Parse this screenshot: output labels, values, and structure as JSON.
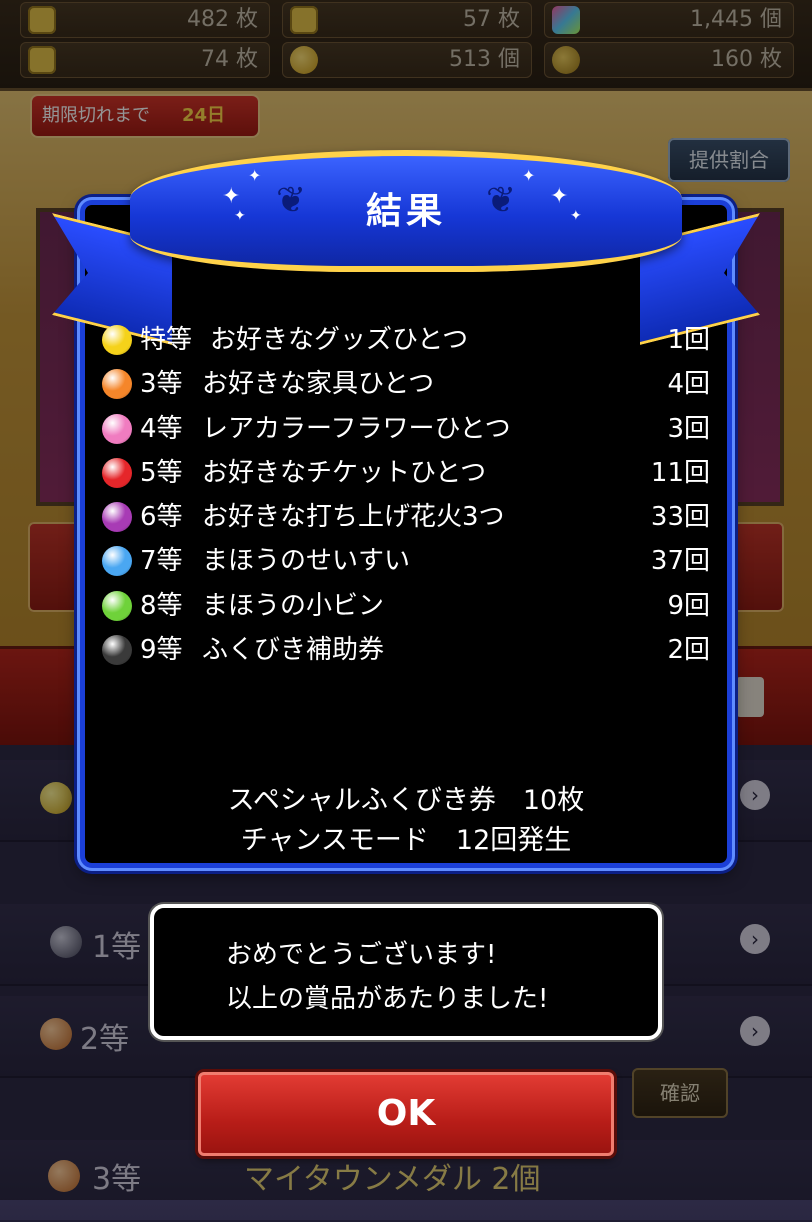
{
  "currencies": [
    {
      "icon": "ticket-icon",
      "value": "482 枚"
    },
    {
      "icon": "ticket-icon",
      "value": "57 枚"
    },
    {
      "icon": "gem-icon",
      "value": "1,445 個"
    },
    {
      "icon": "ticket-icon",
      "value": "74 枚"
    },
    {
      "icon": "coin-icon",
      "value": "513 個"
    },
    {
      "icon": "medal-icon",
      "value": "160 枚"
    }
  ],
  "deadline": {
    "label": "期限切れまで",
    "days": "24日"
  },
  "rate_button": "提供割合",
  "dialog": {
    "title": "結果",
    "prizes": [
      {
        "grade": "特等",
        "name": "お好きなグッズひとつ",
        "count": "1回",
        "color": "#f5d21a"
      },
      {
        "grade": "3等",
        "name": "お好きな家具ひとつ",
        "count": "4回",
        "color": "#f5862a"
      },
      {
        "grade": "4等",
        "name": "レアカラーフラワーひとつ",
        "count": "3回",
        "color": "#f07cc0"
      },
      {
        "grade": "5等",
        "name": "お好きなチケットひとつ",
        "count": "11回",
        "color": "#e5262a"
      },
      {
        "grade": "6等",
        "name": "お好きな打ち上げ花火3つ",
        "count": "33回",
        "color": "#a83bb5"
      },
      {
        "grade": "7等",
        "name": "まほうのせいすい",
        "count": "37回",
        "color": "#4aa7f2"
      },
      {
        "grade": "8等",
        "name": "まほうの小ビン",
        "count": "9回",
        "color": "#6fd23a"
      },
      {
        "grade": "9等",
        "name": "ふくびき補助券",
        "count": "2回",
        "color": "#3a3a3a"
      }
    ],
    "summary_line1": "スペシャルふくびき券　10枚",
    "summary_line2": "チャンスモード　12回発生"
  },
  "congrats": {
    "line1": "おめでとうございます!",
    "line2": "以上の賞品があたりました!"
  },
  "ok_button": "OK",
  "background_list": {
    "rows": [
      {
        "rank": "1等",
        "prize": ""
      },
      {
        "rank": "2等",
        "prize": ""
      },
      {
        "rank": "3等",
        "prize": "マイタウンメダル 2個"
      }
    ],
    "confirm": "確認"
  },
  "colors": {
    "ribbon": "#1f44e6",
    "gold": "#ffd24a",
    "ok": "#c8241d"
  }
}
